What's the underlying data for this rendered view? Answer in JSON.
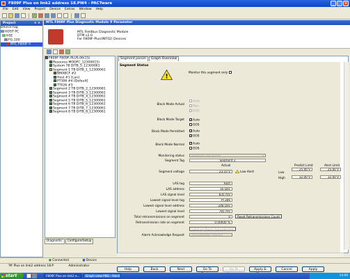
{
  "window": {
    "title": "F809F Plus on link2 address 18.PW4 - PACTware"
  },
  "menu": [
    "File",
    "Edit",
    "View",
    "Project",
    "Device",
    "Extras",
    "Window",
    "Help"
  ],
  "project": {
    "title": "Project",
    "close": "× ×",
    "items": [
      "Device tag",
      "HOST PC",
      "HSE",
      "FG-100",
      "MTL F809F P"
    ]
  },
  "dtm": {
    "title": "MTL F809F Plus Diagnostic Module # Parameter",
    "info": [
      "MTL Fieldbus Diagnostic Module",
      "DTM v2.0",
      "For F809F-Plus(INT02) Devices"
    ]
  },
  "tree": [
    "F809F F809F-PLUS-06(15)",
    "Resource MODFC_12300015)",
    "System 78 DITB_5_12300061",
    "Segment 1 TB DITB_1_12300061",
    "BMABCF #2",
    "Host #1 [Lan]",
    "PT306 #4 [Default]",
    "TT026 #3",
    "Segment 2 TB DITB_2_12300061",
    "Segment 3 TB DITB_3_12300061",
    "Segment 4 TB DITB_4_12300061",
    "Segment 5 TB DITB_5_12300061",
    "Segment 6 TB DITB_6_12300061",
    "Segment 7 TB DITB_7_12300061",
    "Segment 8 TB DITB_8_12300061"
  ],
  "bottom_tabs": [
    "Diagnostic",
    "Configure/Setup"
  ],
  "tabs": [
    "Segment param",
    "Graph Overview"
  ],
  "form": {
    "segment_status": "Segment Status",
    "monitor_label": "Monitor this segment only",
    "block_mode_actual": "Block Mode Actual",
    "block_mode_target": "Block Mode Target",
    "block_mode_permitted": "Block Mode Permitted",
    "block_mode_normal": "Block Mode Normal",
    "opt_auto": "Auto",
    "opt_man": "Man",
    "opt_oos": "OOS",
    "monitoring_status": "Monitoring status",
    "monitoring_value": "Segment monitored",
    "segment_tag": "Segment Tag",
    "segment_tag_value": "Segment 1",
    "actual_hdr": "Actual",
    "segment_voltage": "Segment voltage",
    "voltage_value": "23.10 V",
    "low_alert": "Low Alert",
    "predict_hdr": "Predict Limit",
    "alert_hdr": "Alert Limit",
    "low": "Low",
    "high": "High",
    "low_predict": "25.00 V",
    "low_alert_val": "25.00 V",
    "high_predict": "32.00 V",
    "high_alert_val": "32.00 V",
    "las_tag": "LAS tag",
    "las_tag_value": "Host",
    "las_address": "LAS address",
    "las_address_value": "16 Dec",
    "las_signal": "LAS signal level",
    "las_signal_value": "835 mV",
    "lowest_tag": "Lowest signal level tag",
    "lowest_tag_value": "PT306",
    "lowest_address": "Lowest signal level address",
    "lowest_address_value": "248 Dec",
    "lowest_level": "Lowest signal level",
    "lowest_level_value": "765 mV",
    "total_retrans": "Total retransmissions on segment",
    "total_retrans_value": "0",
    "reset_btn": "Reset Retransmissions Count",
    "retrans_rate": "Retransmission rate on segment",
    "retrans_rate_value": "0.00000 %",
    "latching_btn": "Latching Alarm Acknowledge",
    "alarm_ack": "Alarm Acknowledge Request",
    "alarm_ack_value": "Acknowledge request"
  },
  "buttons": [
    "Help",
    "Back",
    "Next",
    "Go To Devices",
    "Go To Segment",
    "Apply & Close",
    "Cancel",
    "Apply"
  ],
  "status1": {
    "connected": "Connected",
    "device": "Device"
  },
  "status2": {
    "path": "'M' Plus on link2 address 18.P",
    "user": "Administrator"
  },
  "taskbar": {
    "start": "start",
    "tasks": [
      "F809F Plus on link2 a...",
      "Graph view PNG - Paint"
    ],
    "clock": "14:09"
  }
}
